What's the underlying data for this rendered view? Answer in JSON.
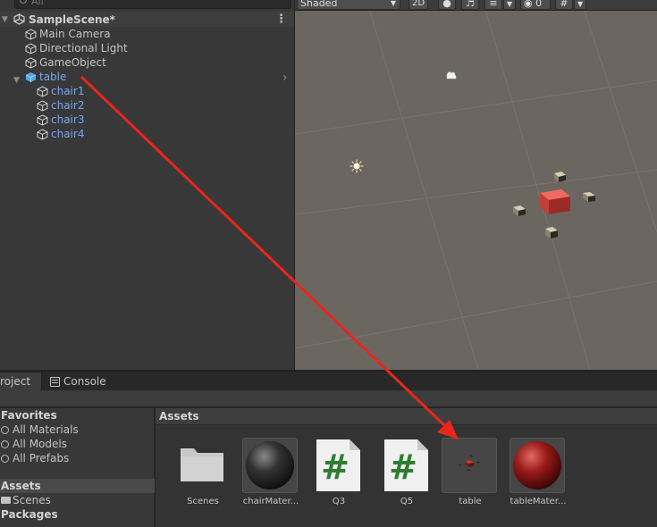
{
  "hierarchy": {
    "search_placeholder": "All",
    "scene_name": "SampleScene*",
    "items": [
      {
        "label": "Main Camera"
      },
      {
        "label": "Directional Light"
      },
      {
        "label": "GameObject"
      },
      {
        "label": "table"
      },
      {
        "label": "chair1"
      },
      {
        "label": "chair2"
      },
      {
        "label": "chair3"
      },
      {
        "label": "chair4"
      }
    ]
  },
  "scene_toolbar": {
    "shading_mode": "Shaded",
    "mode_2d": "2D",
    "hidden_count": "0"
  },
  "bottom_tabs": {
    "project": "roject",
    "console": "Console"
  },
  "project": {
    "favorites_header": "Favorites",
    "favorites": [
      "All Materials",
      "All Models",
      "All Prefabs"
    ],
    "assets_root": "Assets",
    "assets_children": [
      "Scenes"
    ],
    "packages": "Packages",
    "breadcrumb": "Assets",
    "assets": [
      {
        "name": "Scenes",
        "icon": "folder-icon"
      },
      {
        "name": "chairMater...",
        "icon": "material-sphere-icon"
      },
      {
        "name": "Q3",
        "icon": "csharp-script-icon",
        "glyph": "#"
      },
      {
        "name": "Q5",
        "icon": "csharp-script-icon",
        "glyph": "#"
      },
      {
        "name": "table",
        "icon": "prefab-preview-icon"
      },
      {
        "name": "tableMater...",
        "icon": "material-sphere-icon"
      }
    ]
  },
  "colors": {
    "annotation_arrow": "#e8261c",
    "selected_label": "#7ba6e8",
    "script_glyph": "#2e7d32"
  }
}
